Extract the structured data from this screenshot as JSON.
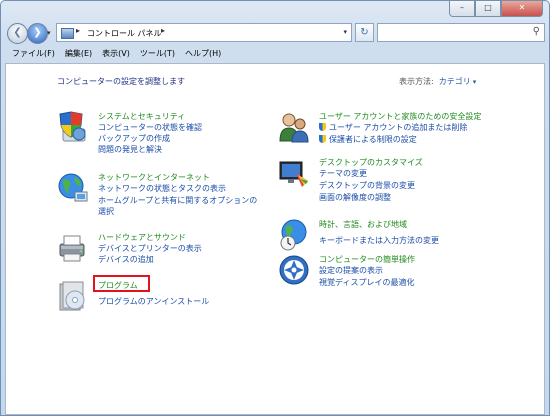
{
  "window": {
    "min": "–",
    "max": "□",
    "close": "✕"
  },
  "address": {
    "crumb": "コントロール パネル",
    "sep1": "▸",
    "sep2": "▸",
    "drop": "▾",
    "search_icon": "search-icon"
  },
  "nav": {
    "back": "❮",
    "forward": "❯",
    "history": "▾",
    "refresh": "↻"
  },
  "menu": [
    "ファイル(F)",
    "編集(E)",
    "表示(V)",
    "ツール(T)",
    "ヘルプ(H)"
  ],
  "page": {
    "title": "コンピューターの設定を調整します",
    "viewby_label": "表示方法:",
    "viewby_value": "カテゴリ",
    "viewby_arrow": "▾"
  },
  "left": [
    {
      "title": "システムとセキュリティ",
      "icon": "shield-computer-icon",
      "links": [
        "コンピューターの状態を確認",
        "バックアップの作成",
        "問題の発見と解決"
      ]
    },
    {
      "title": "ネットワークとインターネット",
      "icon": "globe-network-icon",
      "links": [
        "ネットワークの状態とタスクの表示",
        "ホームグループと共有に関するオプションの",
        "選択"
      ]
    },
    {
      "title": "ハードウェアとサウンド",
      "icon": "printer-speaker-icon",
      "links": [
        "デバイスとプリンターの表示",
        "デバイスの追加"
      ]
    },
    {
      "title": "プログラム",
      "icon": "programs-disc-icon",
      "links": [
        "プログラムのアンインストール"
      ]
    }
  ],
  "right": [
    {
      "title": "ユーザー アカウントと家族のための安全設定",
      "icon": "users-icon",
      "links": [
        "ユーザー アカウントの追加または削除",
        "保護者による制限の設定"
      ]
    },
    {
      "title": "デスクトップのカスタマイズ",
      "icon": "monitor-palette-icon",
      "links": [
        "テーマの変更",
        "デスクトップの背景の変更",
        "画面の解像度の調整"
      ]
    },
    {
      "title": "時計、言語、および地域",
      "icon": "clock-globe-icon",
      "links": [
        "キーボードまたは入力方法の変更"
      ]
    },
    {
      "title": "コンピューターの簡単操作",
      "icon": "ease-of-access-icon",
      "links": [
        "設定の提案の表示",
        "視覚ディスプレイの最適化"
      ]
    }
  ],
  "colors": {
    "category_title": "#1f8a1f",
    "link": "#1a4ca8",
    "highlight": "#e0141e"
  }
}
